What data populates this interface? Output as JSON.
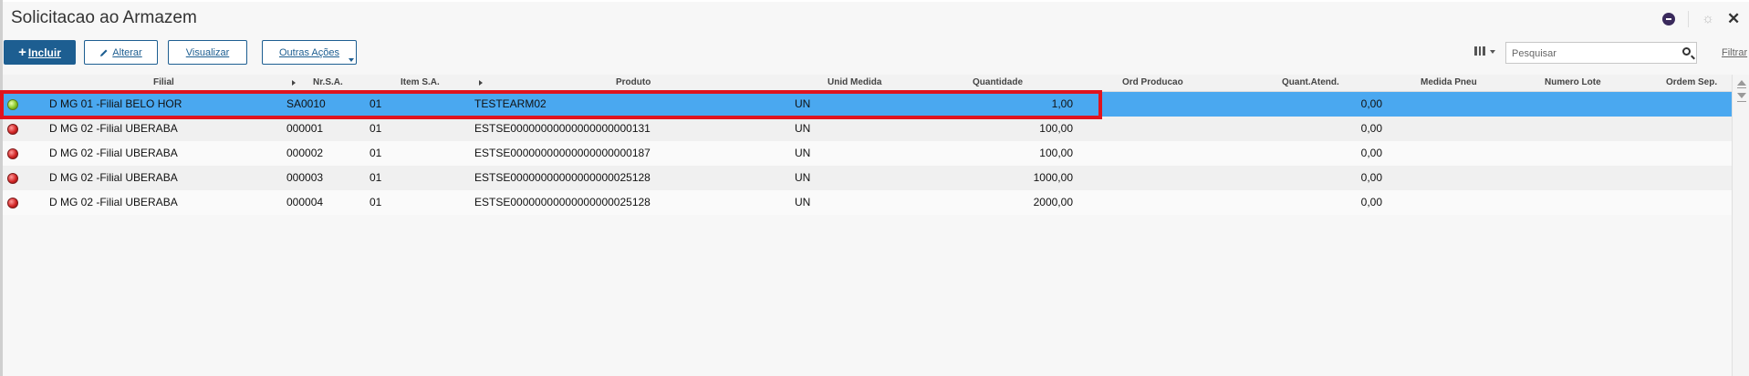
{
  "window": {
    "title": "Solicitacao ao Armazem"
  },
  "toolbar": {
    "incluir_label": "Incluir",
    "alterar_label": "Alterar",
    "visualizar_label": "Visualizar",
    "outras_label": "Outras Ações"
  },
  "search": {
    "placeholder": "Pesquisar",
    "filter_label": "Filtrar"
  },
  "columns": [
    "Filial",
    "Nr.S.A.",
    "Item S.A.",
    "Produto",
    "Unid Medida",
    "Quantidade",
    "Ord Producao",
    "Quant.Atend.",
    "Medida Pneu",
    "Numero Lote",
    "Ordem Sep."
  ],
  "rows": [
    {
      "status": "green",
      "filial": "D MG 01 -Filial BELO HOR",
      "nr_sa": "SA0010",
      "item_sa": "01",
      "produto": "TESTEARM02",
      "unid": "UN",
      "quantidade": "1,00",
      "quant_atend": "0,00",
      "selected": true
    },
    {
      "status": "red",
      "filial": "D MG 02 -Filial UBERABA",
      "nr_sa": "000001",
      "item_sa": "01",
      "produto": "ESTSE00000000000000000000131",
      "unid": "UN",
      "quantidade": "100,00",
      "quant_atend": "0,00",
      "selected": false
    },
    {
      "status": "red",
      "filial": "D MG 02 -Filial UBERABA",
      "nr_sa": "000002",
      "item_sa": "01",
      "produto": "ESTSE00000000000000000000187",
      "unid": "UN",
      "quantidade": "100,00",
      "quant_atend": "0,00",
      "selected": false
    },
    {
      "status": "red",
      "filial": "D MG 02 -Filial UBERABA",
      "nr_sa": "000003",
      "item_sa": "01",
      "produto": "ESTSE00000000000000000025128",
      "unid": "UN",
      "quantidade": "1000,00",
      "quant_atend": "0,00",
      "selected": false
    },
    {
      "status": "red",
      "filial": "D MG 02 -Filial UBERABA",
      "nr_sa": "000004",
      "item_sa": "01",
      "produto": "ESTSE00000000000000000025128",
      "unid": "UN",
      "quantidade": "2000,00",
      "quant_atend": "0,00",
      "selected": false
    }
  ],
  "icons": {
    "status_green": "status-green-icon",
    "status_red": "status-red-icon",
    "search": "search-icon",
    "columns": "columns-icon",
    "settings": "gear-icon",
    "close": "close-icon",
    "avatar": "user-avatar-icon"
  },
  "colors": {
    "primary": "#1d5e91",
    "selected_row": "#4aa8f0",
    "highlight": "#e0141e"
  }
}
